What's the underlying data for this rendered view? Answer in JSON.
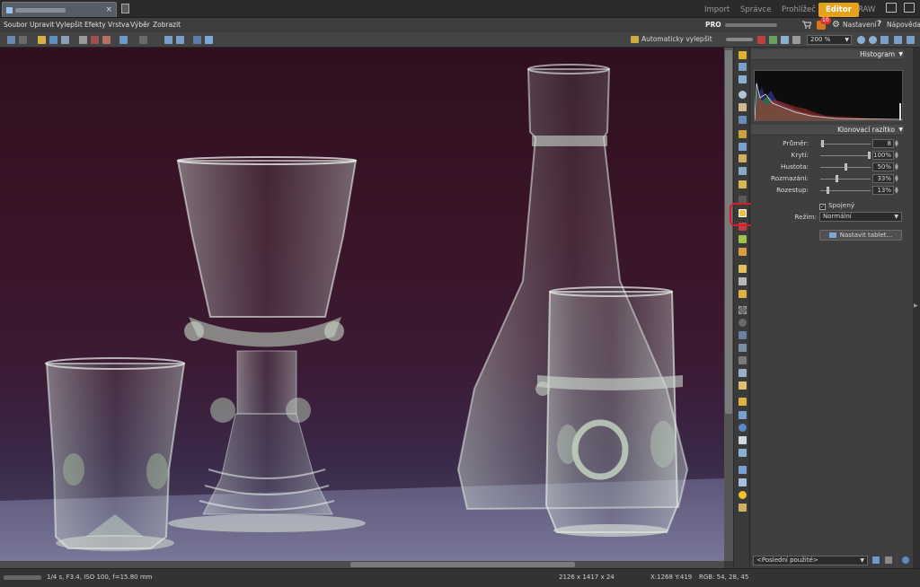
{
  "modes": {
    "import": "Import",
    "spravce": "Správce",
    "prohlizec": "Prohlížeč",
    "editor": "Editor",
    "raw": "RAW"
  },
  "menu": [
    "Soubor",
    "Upravit",
    "Vylepšit",
    "Efekty",
    "Vrstva",
    "Výběr",
    "Zobrazit"
  ],
  "topbar": {
    "pro": "PRO",
    "rss_badge": "10",
    "settings": "Nastavení",
    "help": "Nápověda"
  },
  "toolbar": {
    "auto_enhance": "Automaticky vylepšit",
    "zoom": "200 %"
  },
  "panel": {
    "histogram_title": "Histogram",
    "tool_title": "Klonovací razítko",
    "params": [
      {
        "label": "Průměr:",
        "value": "8",
        "level": 0.02
      },
      {
        "label": "Krytí:",
        "value": "100%",
        "level": 1.0
      },
      {
        "label": "Hustota:",
        "value": "50%",
        "level": 0.5
      },
      {
        "label": "Rozmazání:",
        "value": "33%",
        "level": 0.33
      },
      {
        "label": "Rozestup:",
        "value": "13%",
        "level": 0.13
      }
    ],
    "linked_label": "Spojený",
    "mode_label": "Režim:",
    "mode_value": "Normální",
    "tablet_button": "Nastavit tablet...",
    "recent_value": "<Poslední použité>"
  },
  "status": {
    "exposure": "1/4 s, F3.4, ISO 100, f=15.80 mm",
    "dimensions": "2126 x 1417 x 24",
    "coords": "X:1268 Y:419",
    "rgb": "RGB: 54, 28, 45"
  },
  "colors": {
    "accent": "#e5a21a",
    "highlight": "#d9192c"
  }
}
